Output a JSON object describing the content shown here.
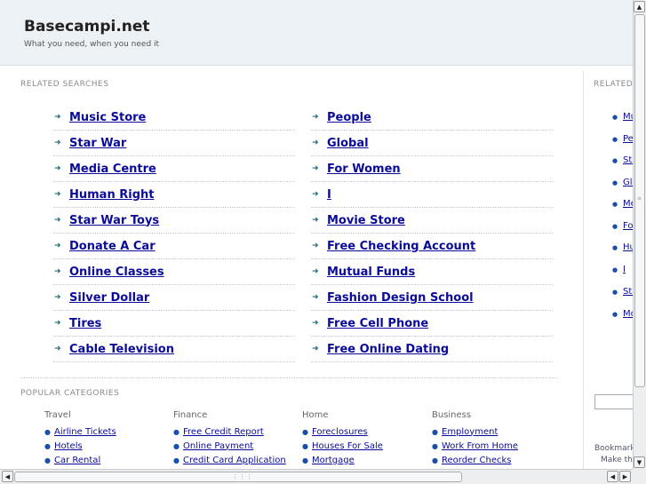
{
  "header": {
    "site_name": "Basecampi.net",
    "tagline": "What you need, when you need it"
  },
  "related_searches": {
    "label": "RELATED SEARCHES",
    "left": [
      "Music Store",
      "Star War",
      "Media Centre",
      "Human Right",
      "Star War Toys",
      "Donate A Car",
      "Online Classes",
      "Silver Dollar",
      "Tires",
      "Cable Television"
    ],
    "right": [
      "People",
      "Global",
      "For Women",
      "I",
      "Movie Store",
      "Free Checking Account",
      "Mutual Funds",
      "Fashion Design School",
      "Free Cell Phone",
      "Free Online Dating"
    ]
  },
  "popular_categories": {
    "label": "POPULAR CATEGORIES",
    "columns": [
      {
        "heading": "Travel",
        "links": [
          "Airline Tickets",
          "Hotels",
          "Car Rental"
        ]
      },
      {
        "heading": "Finance",
        "links": [
          "Free Credit Report",
          "Online Payment",
          "Credit Card Application"
        ]
      },
      {
        "heading": "Home",
        "links": [
          "Foreclosures",
          "Houses For Sale",
          "Mortgage"
        ]
      },
      {
        "heading": "Business",
        "links": [
          "Employment",
          "Work From Home",
          "Reorder Checks"
        ]
      }
    ]
  },
  "sidebar": {
    "label": "RELATED",
    "items": [
      "Mu",
      "Pe",
      "Sta",
      "Glo",
      "Me",
      "Fo",
      "Hu",
      "I",
      "Sta",
      "Mo"
    ],
    "bookmark_text": "Bookmark",
    "make_text": "Make thi"
  },
  "icons": {
    "arrow": "right-arrow-icon",
    "bullet": "bullet-icon"
  },
  "colors": {
    "link": "#0b0b9a",
    "header_bg": "#ecf1f5",
    "arrow": "#1a6a7a"
  }
}
